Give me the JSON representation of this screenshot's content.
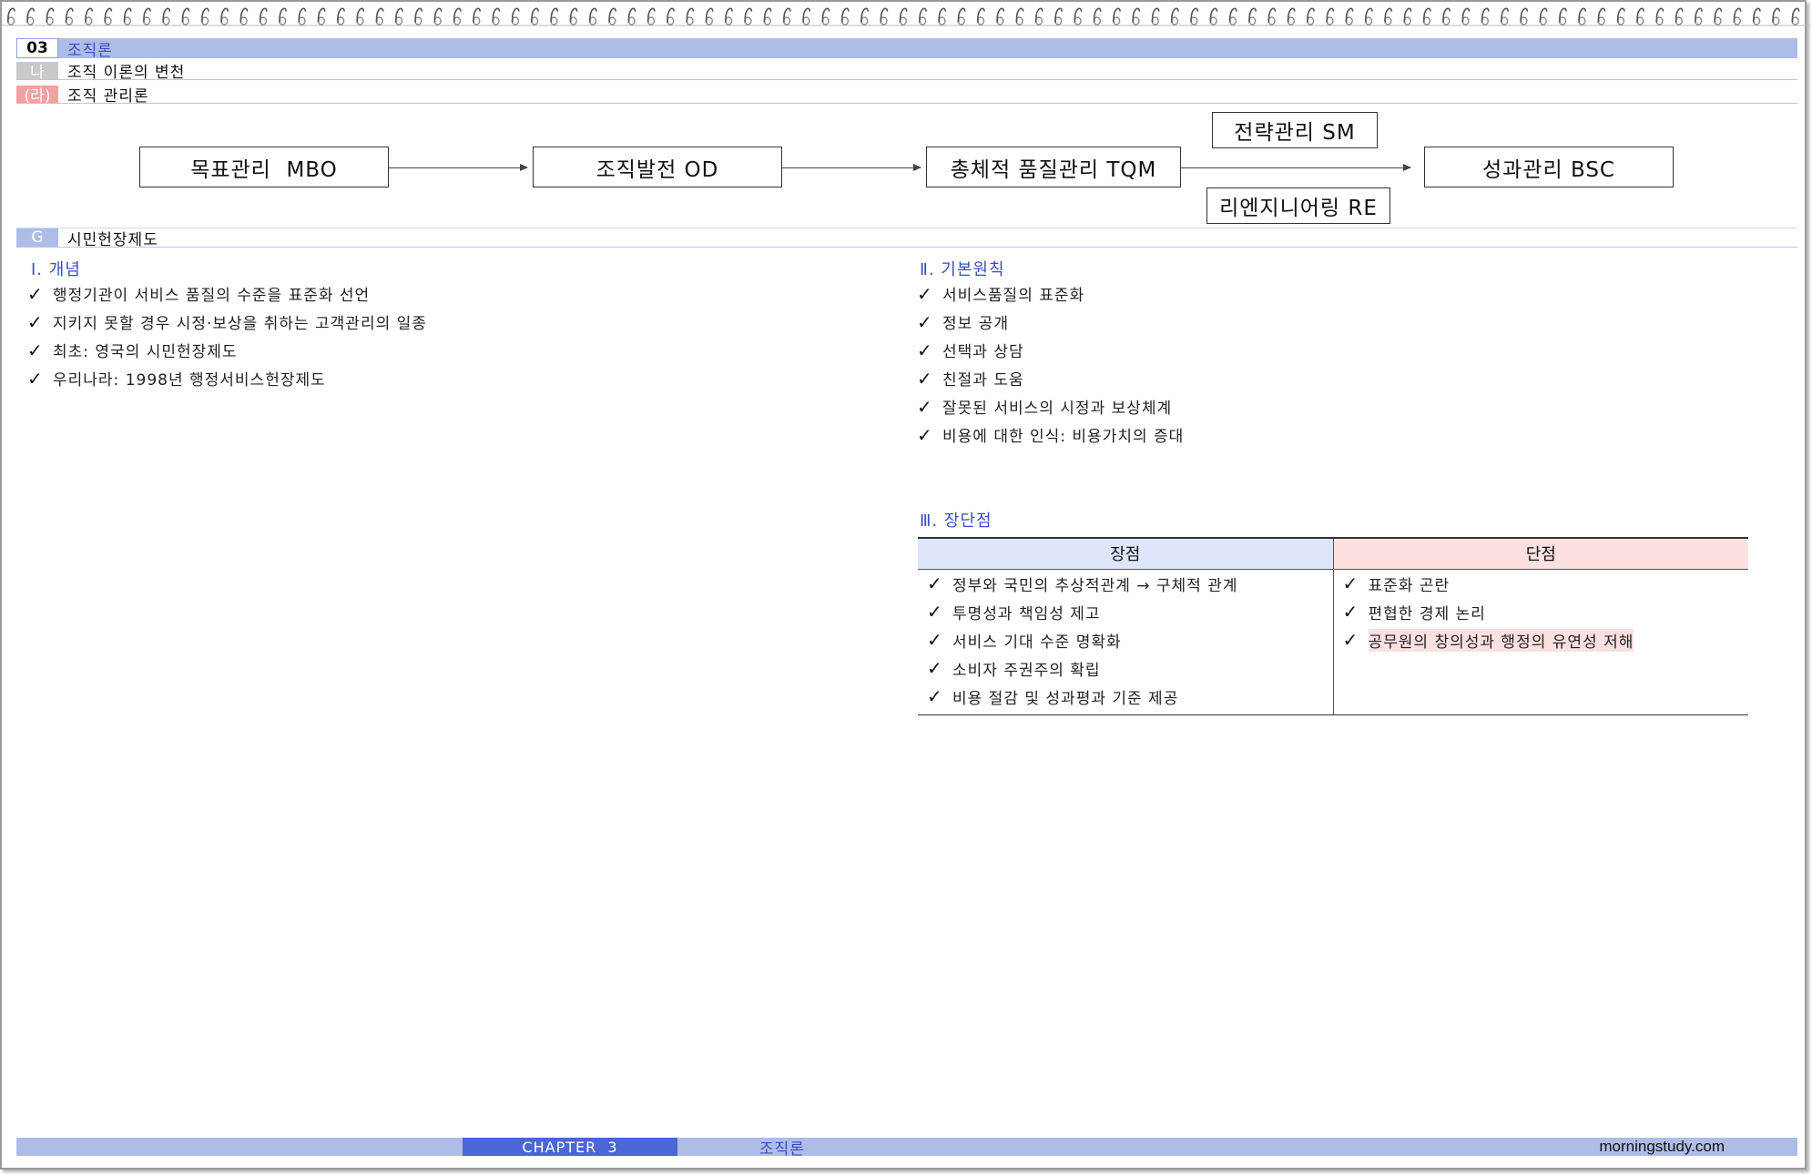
{
  "header": {
    "chapter_num": "03",
    "chapter_title": "조직론",
    "section_tag": "나",
    "section_title": "조직 이론의 변천",
    "sub_tag": "(라)",
    "sub_title": "조직 관리론"
  },
  "flow": {
    "mbo": "목표관리  MBO",
    "od": "조직발전 OD",
    "tqm": "총체적 품질관리 TQM",
    "sm": "전략관리 SM",
    "re": "리엔지니어링 RE",
    "bsc": "성과관리 BSC"
  },
  "section_g": {
    "tag": "G",
    "title": "시민헌장제도"
  },
  "concept": {
    "title": "Ⅰ. 개념",
    "items": [
      "행정기관이 서비스 품질의 수준을 표준화 선언",
      "지키지 못할 경우 시정·보상을 취하는 고객관리의 일종",
      "최초: 영국의 시민헌장제도",
      "우리나라: 1998년 행정서비스헌장제도"
    ]
  },
  "principles": {
    "title": "Ⅱ. 기본원칙",
    "items": [
      "서비스품질의 표준화",
      "정보 공개",
      "선택과 상담",
      "친절과 도움",
      "잘못된 서비스의 시정과 보상체계",
      "비용에 대한 인식: 비용가치의 증대"
    ]
  },
  "proscons": {
    "title": "Ⅲ. 장단점",
    "pros_header": "장점",
    "cons_header": "단점",
    "pros": [
      "정부와 국민의 추상적관계 → 구체적 관계",
      "투명성과 책임성 제고",
      "서비스 기대 수준 명확화",
      "소비자 주권주의 확립",
      "비용 절감 및 성과평과 기준 제공"
    ],
    "cons": [
      "표준화 곤란",
      "편협한 경제 논리",
      "공무원의 창의성과 행정의 유연성 저해"
    ]
  },
  "check_glyph": "✓",
  "footer": {
    "chapter": "CHAPTER  3",
    "title": "조직론",
    "site": "morningstudy.com"
  }
}
